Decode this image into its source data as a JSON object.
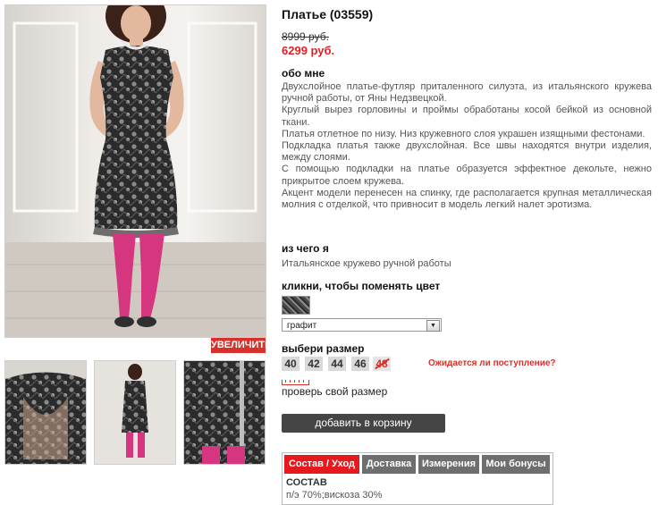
{
  "product": {
    "title": "Платье (03559)",
    "old_price": "8999 руб.",
    "new_price": "6299 руб."
  },
  "about": {
    "heading": "обо мне",
    "paragraphs": [
      "Двухслойное платье-футляр приталенного силуэта, из итальянского кружева ручной работы, от Яны Недзвецкой.",
      "Круглый вырез горловины и проймы обработаны косой бейкой из основной ткани.",
      "Платья отлетное по низу. Низ кружевного слоя украшен изящными фестонами.",
      "Подкладка платья также двухслойная. Все швы находятся внутри изделия, между слоями.",
      "С помощью подкладки на платье образуется эффектное декольте, нежно прикрытое слоем кружева.",
      "Акцент модели перенесен на спинку, где располагается крупная металлическая молния с отделкой, что привносит в модель легкий налет эротизма."
    ]
  },
  "material": {
    "heading": "из чего я",
    "text": "Итальянское кружево ручной работы"
  },
  "color": {
    "heading": "кликни, чтобы поменять цвет",
    "selected": "графит"
  },
  "size": {
    "heading": "выбери размер",
    "options": [
      {
        "label": "40",
        "available": true
      },
      {
        "label": "42",
        "available": true
      },
      {
        "label": "44",
        "available": true
      },
      {
        "label": "46",
        "available": true
      },
      {
        "label": "48",
        "available": false
      }
    ],
    "notify_label": "Ожидается ли поступление?",
    "check_label": "проверь свой размер"
  },
  "gallery": {
    "zoom_label": "УВЕЛИЧИТЬ"
  },
  "cart": {
    "add_label": "добавить в корзину"
  },
  "tabs": {
    "items": [
      "Состав / Уход",
      "Доставка",
      "Измерения",
      "Мои бонусы"
    ],
    "active": 0,
    "content_heading": "СОСТАВ",
    "content_text": "п/э 70%;вискоза 30%"
  },
  "colors": {
    "accent_red": "#e31e24",
    "button_dark": "#454545",
    "tab_gray": "#6e6e6e",
    "legs_pink": "#d6357f"
  }
}
